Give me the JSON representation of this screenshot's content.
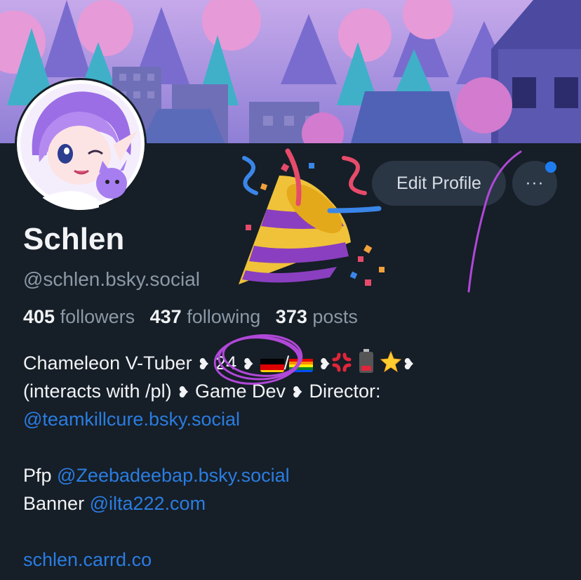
{
  "profile": {
    "display_name": "Schlen",
    "handle": "@schlen.bsky.social"
  },
  "actions": {
    "edit_label": "Edit Profile",
    "more_label": "···"
  },
  "stats": {
    "followers_count": "405",
    "followers_label": "followers",
    "following_count": "437",
    "following_label": "following",
    "posts_count": "373",
    "posts_label": "posts"
  },
  "bio": {
    "l1_text": "Chameleon V-Tuber ",
    "sep": "❥",
    "age": " 24 ",
    "slash": "/",
    "l2_text": "(interacts with /pl) ",
    "game_dev": " Game Dev ",
    "director": " Director:",
    "team_link": "@teamkillcure.bsky.social",
    "pfp_label": "Pfp ",
    "pfp_link": "@Zeebadeebap.bsky.social",
    "banner_label": "Banner ",
    "banner_link": "@ilta222.com",
    "site_link": "schlen.carrd.co"
  },
  "icons": [
    "party-popper-icon",
    "flag-germany-icon",
    "rainbow-flag-icon",
    "anger-icon",
    "low-battery-icon",
    "glowing-star-icon",
    "more-dots-icon"
  ],
  "colors": {
    "background": "#161e27",
    "link": "#2a7de1",
    "button": "#2a3644",
    "notification": "#1e7cf0",
    "annotation": "#b048d8"
  }
}
